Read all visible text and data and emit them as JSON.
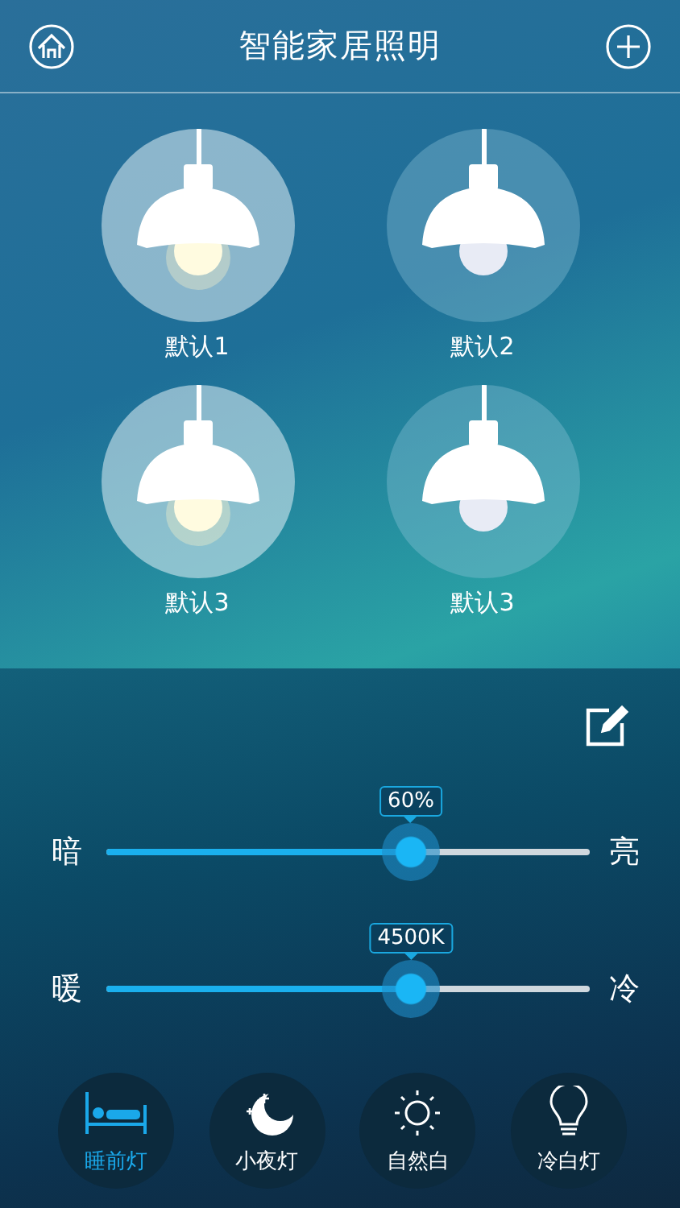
{
  "header": {
    "title": "智能家居照明"
  },
  "lamps": [
    {
      "label": "默认1",
      "on": true
    },
    {
      "label": "默认2",
      "on": false
    },
    {
      "label": "默认3",
      "on": true
    },
    {
      "label": "默认3",
      "on": false
    }
  ],
  "sliders": [
    {
      "left": "暗",
      "right": "亮",
      "reading": "60%",
      "level": 0.63
    },
    {
      "left": "暖",
      "right": "冷",
      "reading": "4500K",
      "level": 0.63
    }
  ],
  "modes": [
    {
      "kind": "bed",
      "label": "睡前灯",
      "selected": true
    },
    {
      "kind": "moon",
      "label": "小夜灯",
      "selected": false
    },
    {
      "kind": "sun",
      "label": "自然白",
      "selected": false
    },
    {
      "kind": "bulb",
      "label": "冷白灯",
      "selected": false
    }
  ]
}
